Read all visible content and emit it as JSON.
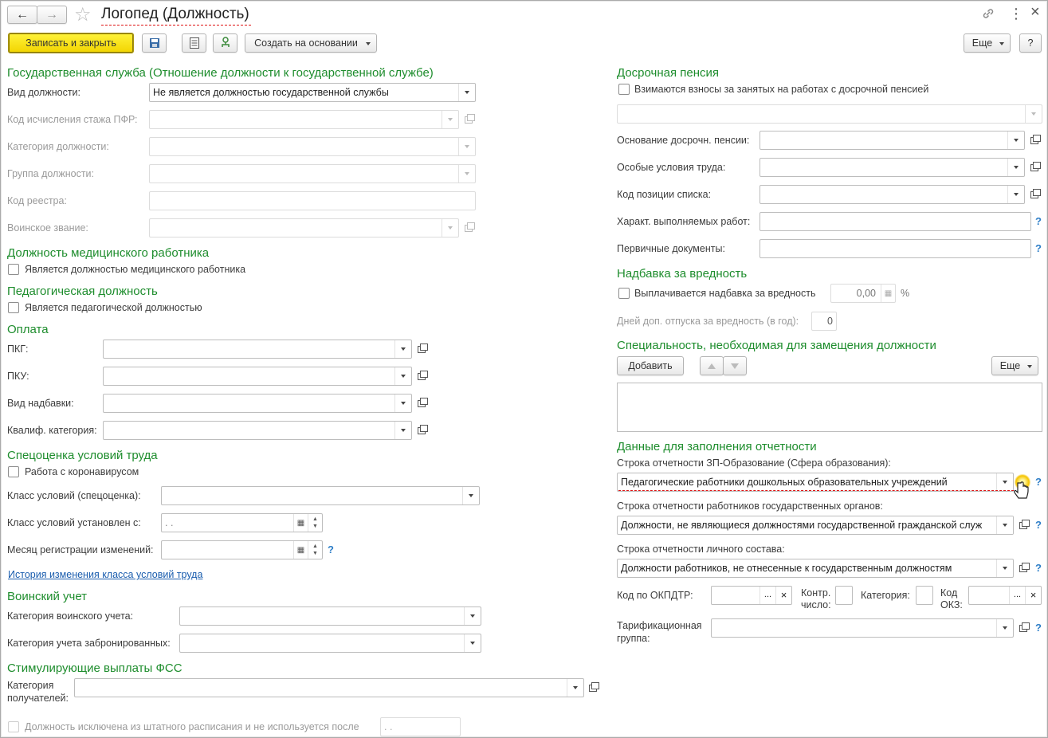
{
  "window": {
    "title": "Логопед (Должность)"
  },
  "toolbar": {
    "save_close": "Записать и закрыть",
    "create_based": "Создать на основании",
    "more": "Еще",
    "help": "?"
  },
  "gov": {
    "title": "Государственная служба (Отношение должности к государственной службе)",
    "kind_label": "Вид должности:",
    "kind_value": "Не является должностью государственной службы",
    "pfr_label": "Код исчисления стажа ПФР:",
    "category_label": "Категория должности:",
    "group_label": "Группа должности:",
    "registry_label": "Код реестра:",
    "rank_label": "Воинское звание:"
  },
  "medical": {
    "title": "Должность медицинского работника",
    "checkbox": "Является должностью медицинского работника"
  },
  "pedagogical": {
    "title": "Педагогическая должность",
    "checkbox": "Является педагогической должностью"
  },
  "payment": {
    "title": "Оплата",
    "pkg": "ПКГ:",
    "pku": "ПКУ:",
    "bonus": "Вид надбавки:",
    "qualif": "Квалиф. категория:"
  },
  "special": {
    "title": "Спецоценка условий труда",
    "covid": "Работа с коронавирусом",
    "class_label": "Класс условий (спецоценка):",
    "class_date_label": "Класс условий установлен с:",
    "date_placeholder": " .  .",
    "month_label": "Месяц регистрации изменений:",
    "history_link": "История изменения класса условий труда"
  },
  "military": {
    "title": "Воинский учет",
    "cat_label": "Категория воинского учета:",
    "reserved_label": "Категория учета забронированных:"
  },
  "fss": {
    "title": "Стимулирующие выплаты ФСС",
    "label_1": "Категория",
    "label_2": "получателей:"
  },
  "excluded": {
    "checkbox": "Должность исключена из штатного расписания и не используется после",
    "date": " .  ."
  },
  "early": {
    "title": "Досрочная пенсия",
    "checkbox": "Взимаются взносы за занятых на работах с досрочной пенсией",
    "basis_label": "Основание досрочн. пенсии:",
    "special_label": "Особые условия труда:",
    "position_label": "Код позиции списка:",
    "works_label": "Характ. выполняемых работ:",
    "docs_label": "Первичные документы:"
  },
  "hazard": {
    "title": "Надбавка за вредность",
    "checkbox": "Выплачивается надбавка за вредность",
    "value": "0,00",
    "percent": "%",
    "days_label": "Дней доп. отпуска за вредность (в год):",
    "days_value": "0"
  },
  "specialty": {
    "title": "Специальность, необходимая для замещения должности",
    "add": "Добавить",
    "more": "Еще"
  },
  "reporting": {
    "title": "Данные для заполнения отчетности",
    "zp_label": "Строка отчетности ЗП-Образование (Сфера образования):",
    "zp_value": "Педагогические работники дошкольных образовательных учреждений",
    "gov_label": "Строка отчетности работников государственных органов:",
    "gov_value": "Должности, не являющиеся должностями государственной гражданской служ",
    "staff_label": "Строка отчетности личного состава:",
    "staff_value": "Должности работников, не отнесенные к государственным должностям",
    "okpdtr_label": "Код по ОКПДТР:",
    "ctrl_label_1": "Контр.",
    "ctrl_label_2": "число:",
    "category_label": "Категория:",
    "okz_label_1": "Код",
    "okz_label_2": "ОКЗ:",
    "tarif_label_1": "Тарификационная",
    "tarif_label_2": "группа:",
    "ellipsis": "...",
    "clear": "×"
  },
  "icons": {
    "back": "←",
    "forward": "→",
    "star": "☆",
    "link": "🔗",
    "kebab": "⋮",
    "close": "×",
    "help": "?",
    "up": "▲",
    "down": "▼",
    "calendar": "▦"
  }
}
